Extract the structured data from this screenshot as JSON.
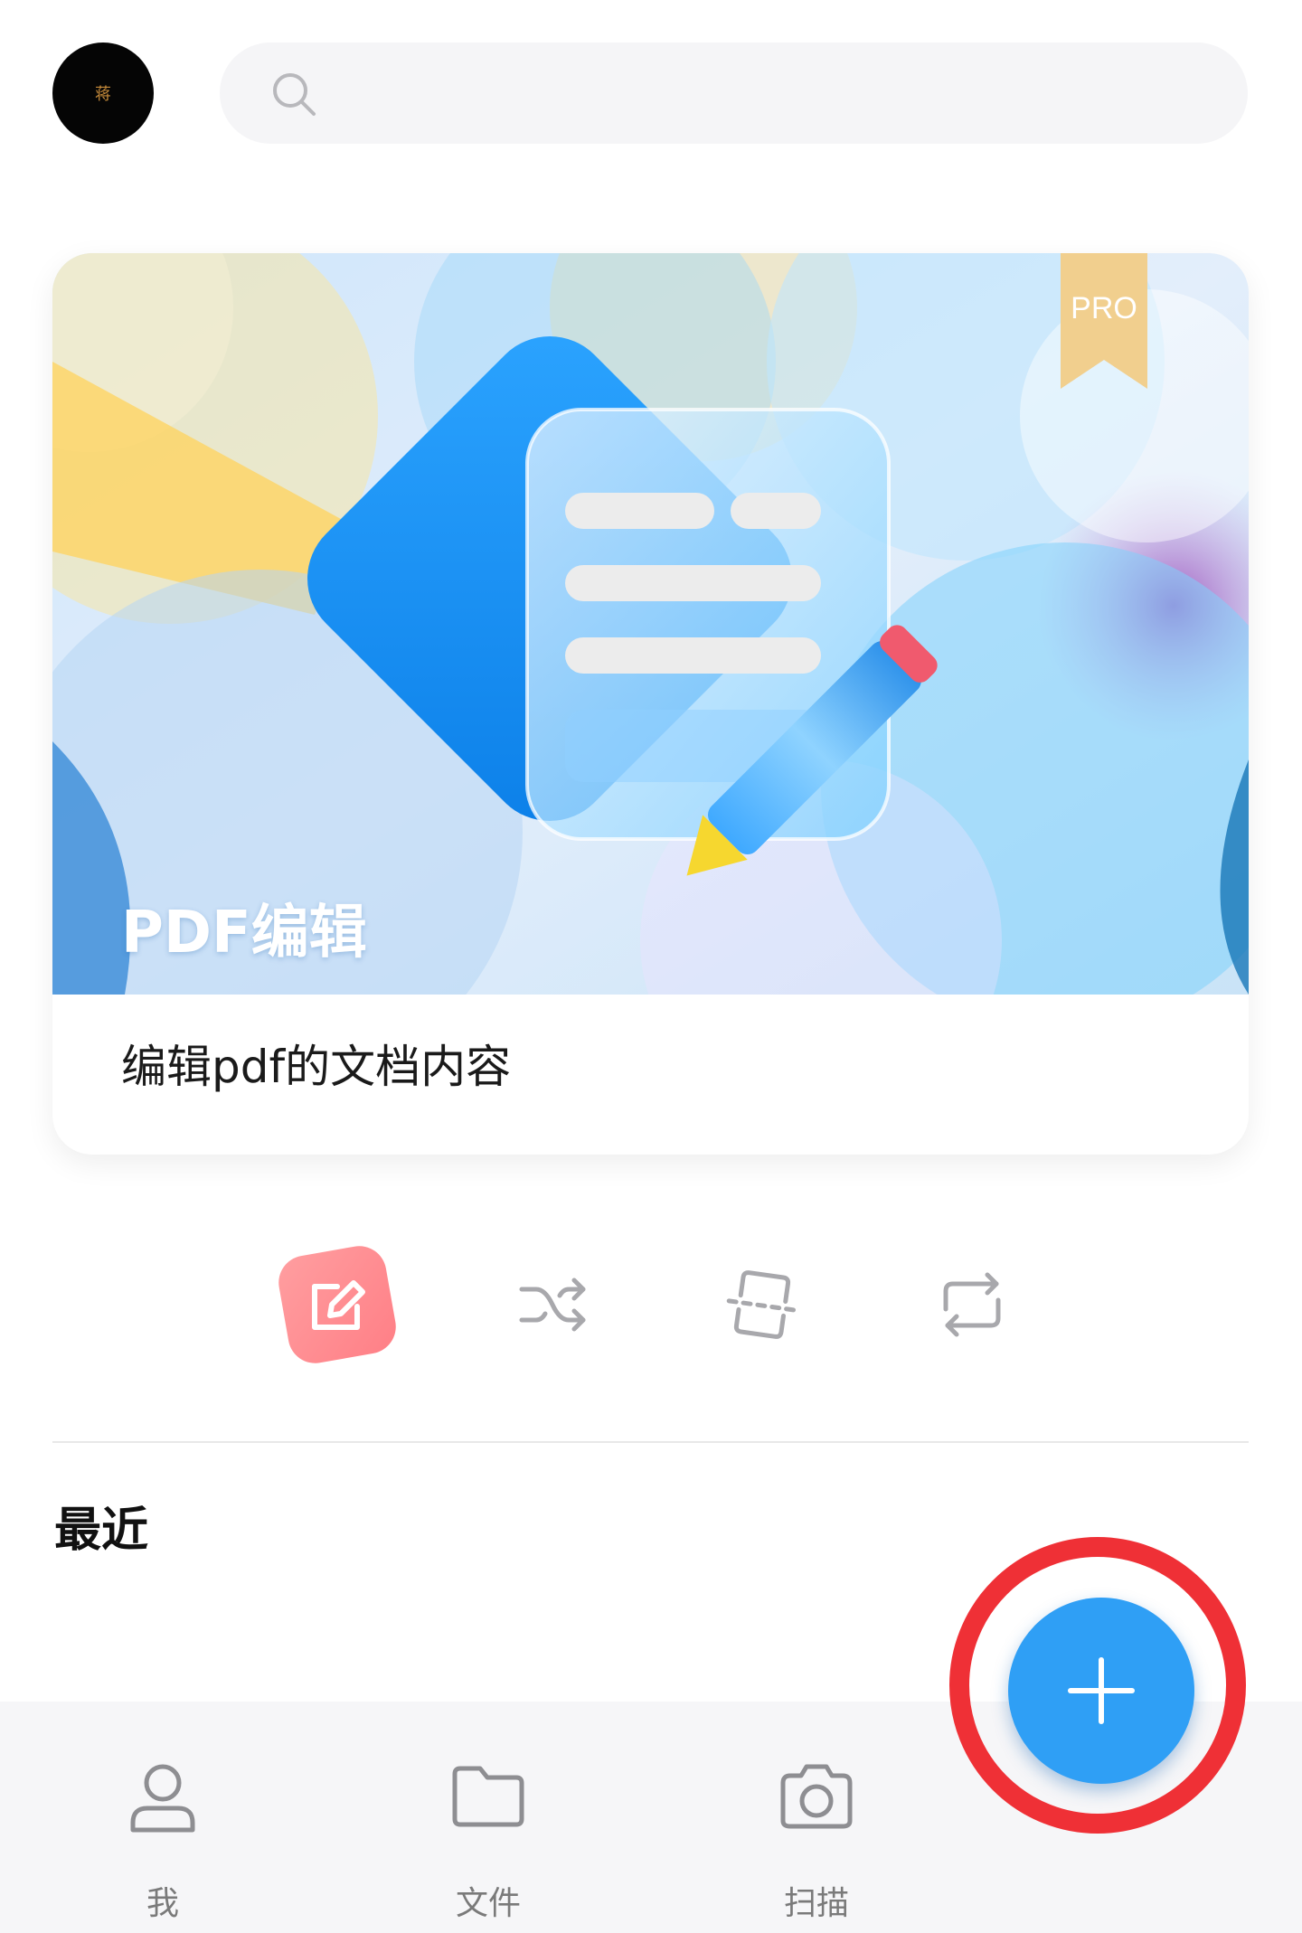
{
  "header": {
    "avatar_text": "蒋",
    "search": {
      "placeholder": "",
      "icon": "search-icon"
    }
  },
  "feature_card": {
    "banner_title": "PDF编辑",
    "badge": "PRO",
    "description": "编辑pdf的文档内容",
    "illustration": "document-edit-pencil"
  },
  "tools": [
    {
      "name": "edit",
      "icon": "edit-icon",
      "active": true,
      "color": "#ff8e92"
    },
    {
      "name": "convert",
      "icon": "shuffle-icon",
      "active": false
    },
    {
      "name": "scan-document",
      "icon": "scan-icon",
      "active": false
    },
    {
      "name": "sync",
      "icon": "refresh-icon",
      "active": false
    }
  ],
  "recent": {
    "title": "最近"
  },
  "bottom_nav": [
    {
      "label": "我",
      "icon": "user-icon"
    },
    {
      "label": "文件",
      "icon": "folder-icon"
    },
    {
      "label": "扫描",
      "icon": "camera-icon"
    }
  ],
  "fab": {
    "icon": "plus-icon",
    "color": "#2f9ff5",
    "highlight_color": "#ef3036"
  }
}
